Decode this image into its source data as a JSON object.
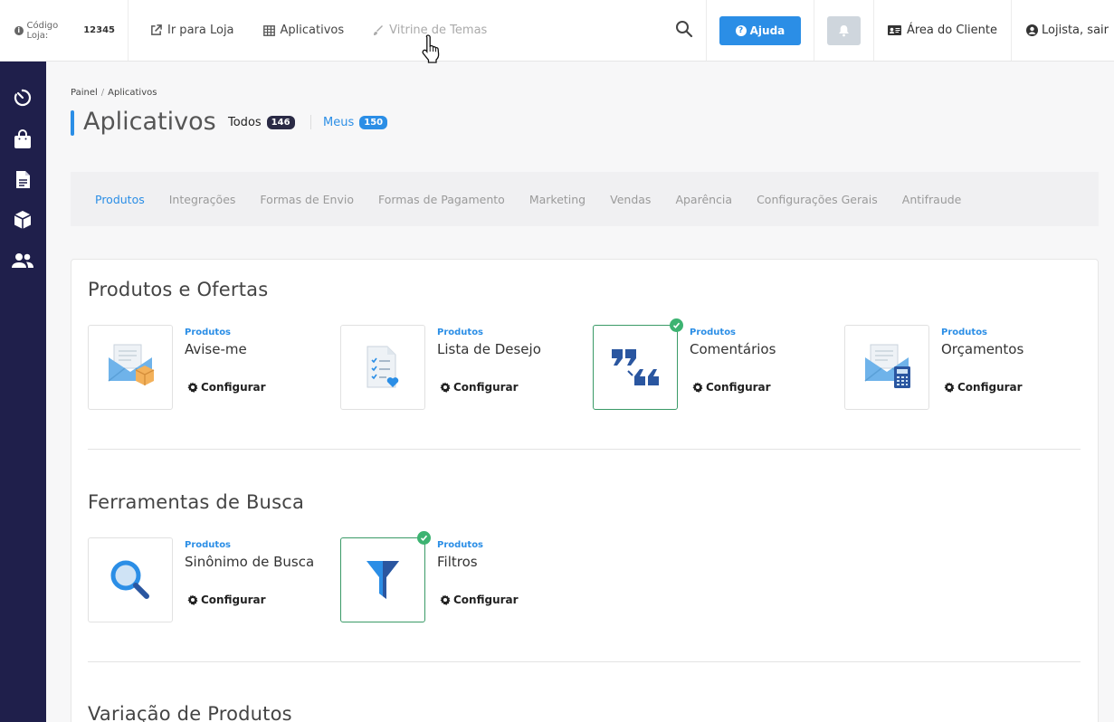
{
  "topbar": {
    "store_code_label": "Código Loja:",
    "store_code_value": "12345",
    "nav": {
      "go_to_store": "Ir para Loja",
      "apps": "Aplicativos",
      "themes": "Vitrine de Temas"
    },
    "help_label": "Ajuda",
    "client_area": "Área do Cliente",
    "logout": "Lojista, sair"
  },
  "sidebar": {
    "items": [
      {
        "icon": "dashboard-timer-icon"
      },
      {
        "icon": "shopping-bag-icon"
      },
      {
        "icon": "document-icon"
      },
      {
        "icon": "box-icon"
      },
      {
        "icon": "users-icon"
      }
    ]
  },
  "breadcrumb": {
    "home": "Painel",
    "separator": "/",
    "current": "Aplicativos"
  },
  "page": {
    "title": "Aplicativos",
    "filters": {
      "all_label": "Todos",
      "all_count": "146",
      "mine_label": "Meus",
      "mine_count": "150"
    }
  },
  "categories": [
    "Produtos",
    "Integrações",
    "Formas de Envio",
    "Formas de Pagamento",
    "Marketing",
    "Vendas",
    "Aparência",
    "Configurações Gerais",
    "Antifraude"
  ],
  "active_category": "Produtos",
  "sections": [
    {
      "title": "Produtos e Ofertas",
      "apps": [
        {
          "category": "Produtos",
          "name": "Avise-me",
          "action": "Configurar",
          "installed": false
        },
        {
          "category": "Produtos",
          "name": "Lista de Desejo",
          "action": "Configurar",
          "installed": false
        },
        {
          "category": "Produtos",
          "name": "Comentários",
          "action": "Configurar",
          "installed": true
        },
        {
          "category": "Produtos",
          "name": "Orçamentos",
          "action": "Configurar",
          "installed": false
        }
      ]
    },
    {
      "title": "Ferramentas de Busca",
      "apps": [
        {
          "category": "Produtos",
          "name": "Sinônimo de Busca",
          "action": "Configurar",
          "installed": false
        },
        {
          "category": "Produtos",
          "name": "Filtros",
          "action": "Configurar",
          "installed": true
        }
      ]
    },
    {
      "title": "Variação de Produtos",
      "apps": []
    }
  ],
  "colors": {
    "accent": "#2b8ee6",
    "sidebar": "#1f1f4b",
    "installed": "#3cb371"
  }
}
